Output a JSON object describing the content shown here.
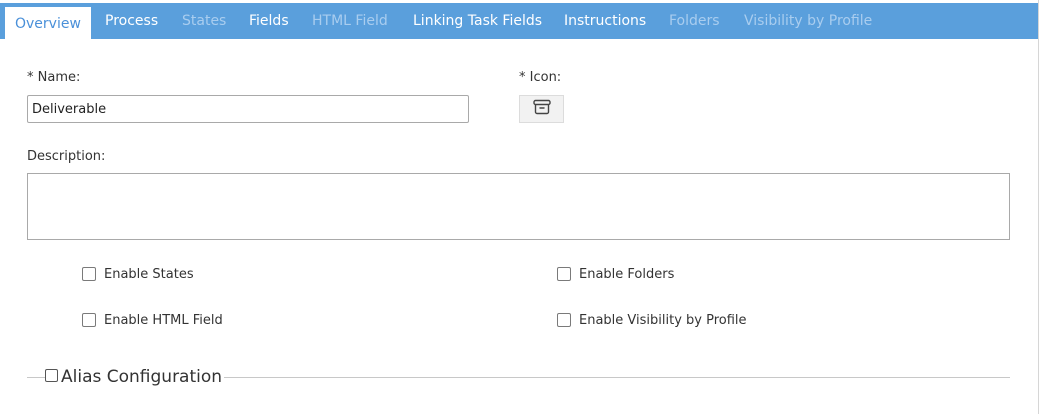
{
  "tabs": [
    {
      "label": "Overview",
      "state": "active"
    },
    {
      "label": "Process",
      "state": "enabled"
    },
    {
      "label": "States",
      "state": "disabled"
    },
    {
      "label": "Fields",
      "state": "enabled"
    },
    {
      "label": "HTML Field",
      "state": "disabled"
    },
    {
      "label": "Linking Task Fields",
      "state": "enabled"
    },
    {
      "label": "Instructions",
      "state": "enabled"
    },
    {
      "label": "Folders",
      "state": "disabled"
    },
    {
      "label": "Visibility by Profile",
      "state": "disabled"
    }
  ],
  "form": {
    "name_label": "* Name:",
    "name_value": "Deliverable",
    "icon_label": "* Icon:",
    "icon_name": "archive-box-icon",
    "description_label": "Description:",
    "description_value": ""
  },
  "options": {
    "enable_states": {
      "label": "Enable States",
      "checked": false
    },
    "enable_folders": {
      "label": "Enable Folders",
      "checked": false
    },
    "enable_html_field": {
      "label": "Enable HTML Field",
      "checked": false
    },
    "enable_visibility": {
      "label": "Enable Visibility by Profile",
      "checked": false
    }
  },
  "alias": {
    "label": "Alias Configuration",
    "checked": false
  },
  "colors": {
    "tab_bar": "#5a9fdc",
    "tab_active_text": "#4a90d9",
    "tab_disabled_text": "#a9cdef"
  }
}
